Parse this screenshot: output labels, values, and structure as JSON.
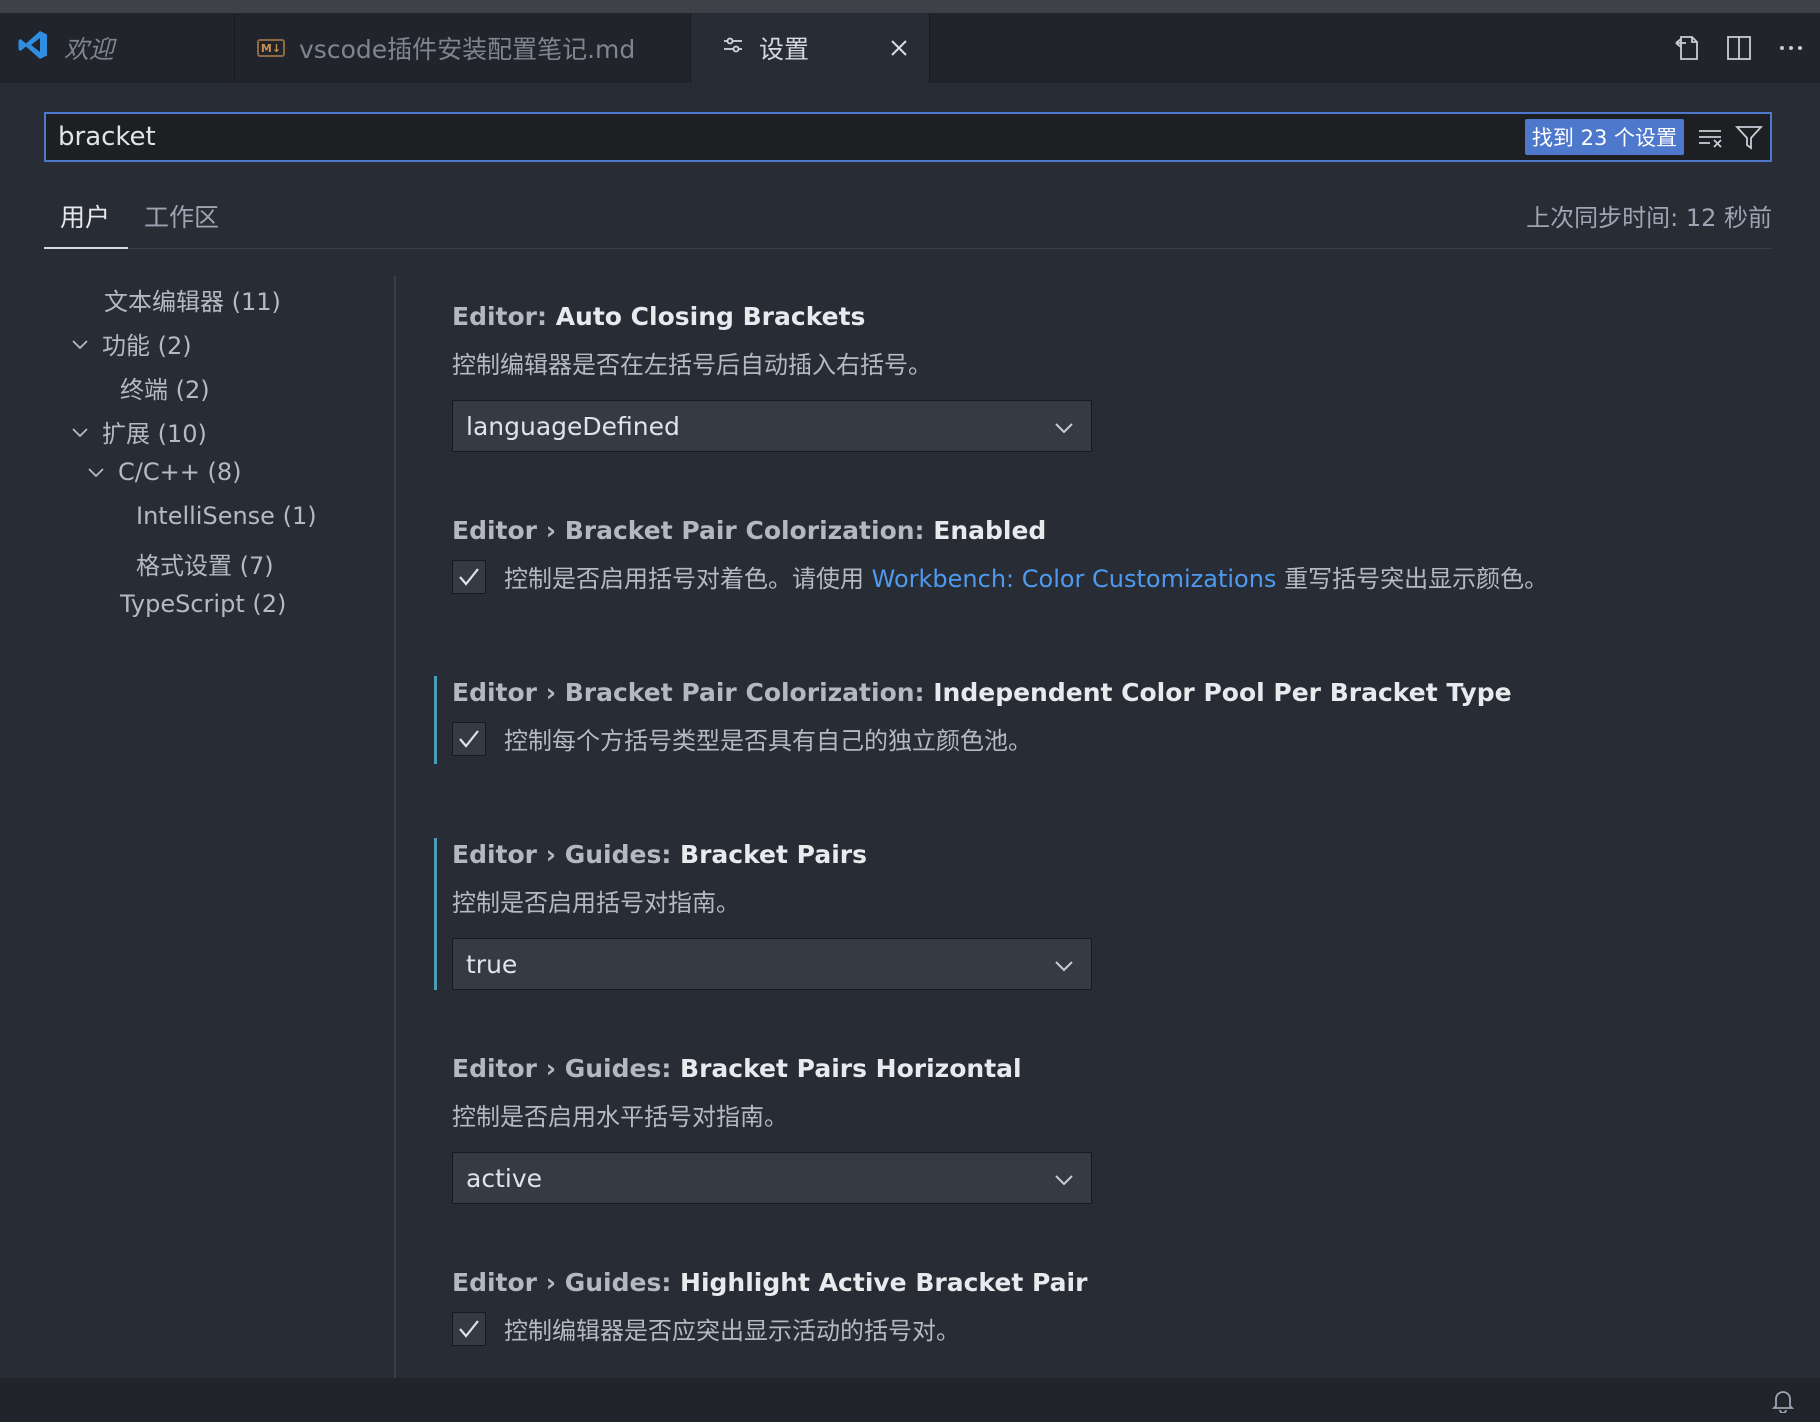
{
  "tabs": [
    {
      "label": "欢迎",
      "icon": "vscode-logo-icon"
    },
    {
      "label": "vscode插件安装配置笔记.md",
      "icon": "markdown-file-icon",
      "icon_text": "M↓"
    },
    {
      "label": "设置",
      "icon": "settings-sliders-icon",
      "active": true
    }
  ],
  "tabbar_actions": [
    "open-settings-json-icon",
    "split-editor-icon",
    "more-actions-icon"
  ],
  "search": {
    "value": "bracket",
    "result_count": "找到 23 个设置"
  },
  "scope_tabs": {
    "user": "用户",
    "workspace": "工作区",
    "sync": "上次同步时间: 12 秒前"
  },
  "toc": [
    {
      "label": "文本编辑器 (11)",
      "level": 0,
      "expanded": null
    },
    {
      "label": "功能 (2)",
      "level": 0,
      "expanded": true
    },
    {
      "label": "终端 (2)",
      "level": 1,
      "expanded": null
    },
    {
      "label": "扩展 (10)",
      "level": 0,
      "expanded": true
    },
    {
      "label": "C/C++ (8)",
      "level": 1,
      "expanded": true
    },
    {
      "label": "IntelliSense (1)",
      "level": 2,
      "expanded": null
    },
    {
      "label": "格式设置 (7)",
      "level": 2,
      "expanded": null
    },
    {
      "label": "TypeScript (2)",
      "level": 1,
      "expanded": null
    }
  ],
  "settings": [
    {
      "category": "Editor: ",
      "name": "Auto Closing Brackets",
      "desc": "控制编辑器是否在左括号后自动插入右括号。",
      "type": "select",
      "value": "languageDefined"
    },
    {
      "category": "Editor › Bracket Pair Colorization: ",
      "name": "Enabled",
      "desc_prefix": "控制是否启用括号对着色。请使用 ",
      "desc_link": "Workbench: Color Customizations",
      "desc_suffix": " 重写括号突出显示颜色。",
      "type": "checkbox",
      "checked": true
    },
    {
      "category": "Editor › Bracket Pair Colorization: ",
      "name": "Independent Color Pool Per Bracket Type",
      "desc": "控制每个方括号类型是否具有自己的独立颜色池。",
      "type": "checkbox",
      "checked": true,
      "modified": true
    },
    {
      "category": "Editor › Guides: ",
      "name": "Bracket Pairs",
      "desc": "控制是否启用括号对指南。",
      "type": "select",
      "value": "true",
      "modified": true
    },
    {
      "category": "Editor › Guides: ",
      "name": "Bracket Pairs Horizontal",
      "desc": "控制是否启用水平括号对指南。",
      "type": "select",
      "value": "active"
    },
    {
      "category": "Editor › Guides: ",
      "name": "Highlight Active Bracket Pair",
      "desc": "控制编辑器是否应突出显示活动的括号对。",
      "type": "checkbox",
      "checked": true
    }
  ],
  "colors": {
    "accent": "#4d78cc",
    "link": "#4d9af0",
    "modified_bar": "#4a9bb8",
    "vscode_blue": "#2f8ee0"
  }
}
